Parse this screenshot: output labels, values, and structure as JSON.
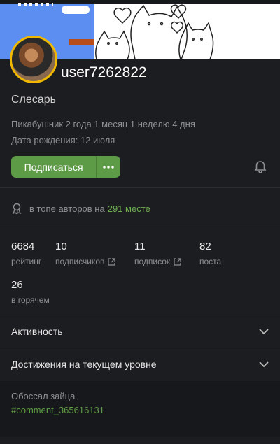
{
  "profile": {
    "username": "user7262822",
    "status": "Слесарь",
    "since": "Пикабушник 2 года 1 месяц 1 неделю 4 дня",
    "birthday": "Дата рождения: 12 июля"
  },
  "actions": {
    "subscribe_label": "Подписаться",
    "more_label": "•••"
  },
  "top_authors": {
    "prefix": "в топе авторов на",
    "rank": "291 месте"
  },
  "stats": [
    {
      "value": "6684",
      "label": "рейтинг"
    },
    {
      "value": "10",
      "label": "подписчиков"
    },
    {
      "value": "11",
      "label": "подписок"
    },
    {
      "value": "82",
      "label": "поста"
    },
    {
      "value": "26",
      "label": "в горячем"
    }
  ],
  "sections": {
    "activity": "Активность",
    "achievements": "Достижения на текущем уровне"
  },
  "comment": {
    "text": "Обоссал зайца",
    "link": "#comment_365616131"
  },
  "colors": {
    "accent_green": "#5e9b47",
    "link_green": "#6fae4f",
    "avatar_ring": "#f0b800",
    "background": "#1c1d20"
  },
  "icons": [
    "bell-icon",
    "medal-icon",
    "external-link-icon",
    "chevron-down-icon",
    "more-dots-icon"
  ]
}
